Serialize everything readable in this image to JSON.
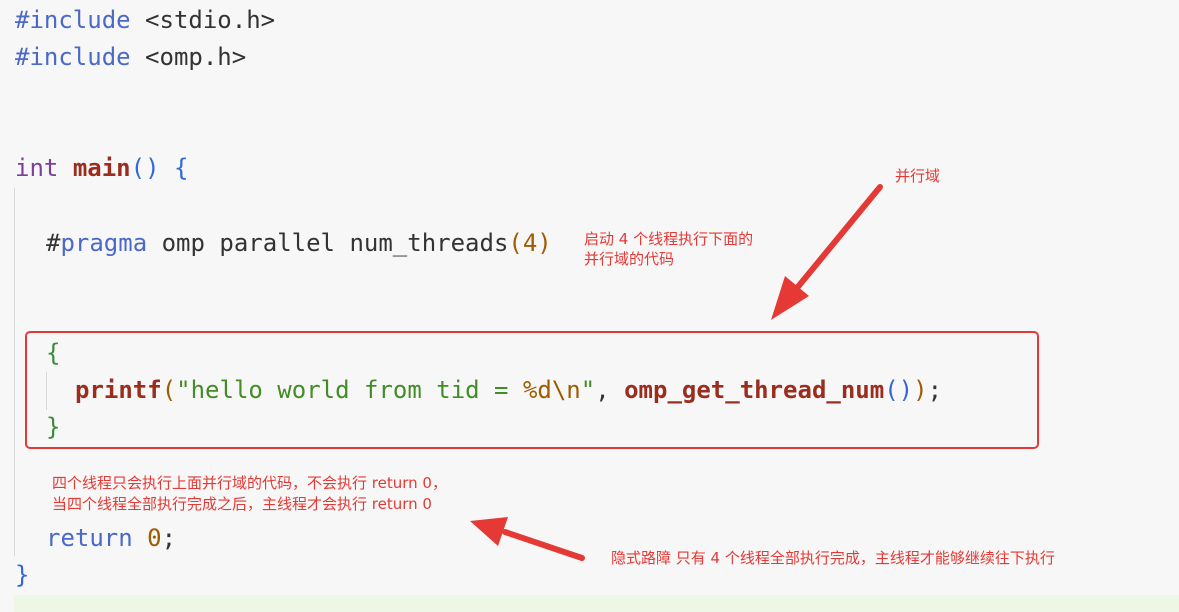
{
  "code": {
    "l1": {
      "directive": "#include",
      "header": "<stdio.h>"
    },
    "l2": {
      "directive": "#include",
      "header": "<omp.h>"
    },
    "l3": {
      "type": "int",
      "name": "main",
      "open_paren": "(",
      "close_paren": ")",
      "brace": "{"
    },
    "l4": {
      "hash": "#",
      "pragma": "pragma",
      "rest": "omp parallel num_threads",
      "open_paren": "(",
      "num": "4",
      "close_paren": ")"
    },
    "l5": {
      "brace": "{"
    },
    "l6": {
      "fn": "printf",
      "open_paren": "(",
      "str_open": "\"",
      "str_text": "hello world from tid = ",
      "fmt": "%d\\n",
      "str_close": "\"",
      "comma": ", ",
      "call": "omp_get_thread_num",
      "call_parens": "()",
      "close_paren": ")",
      "semi": ";"
    },
    "l7": {
      "brace": "}"
    },
    "l8": {
      "kw": "return",
      "num": "0",
      "semi": ";"
    },
    "l9": {
      "brace": "}"
    }
  },
  "annotations": {
    "parallel_region": "并行域",
    "pragma_note_1": "启动 4 个线程执行下面的",
    "pragma_note_2": "并行域的代码",
    "block_note_1": "四个线程只会执行上面并行域的代码，不会执行 return 0，",
    "block_note_2": "当四个线程全部执行完成之后，主线程才会执行 return 0",
    "barrier_note": "隐式路障 只有 4 个线程全部执行完成，主线程才能够继续往下执行"
  },
  "colors": {
    "annotation": "#e53935",
    "preprocessor": "#4b69c6",
    "type": "#7a3e9d",
    "function": "#9a2d1e",
    "string": "#448c27",
    "number": "#a05a00"
  }
}
